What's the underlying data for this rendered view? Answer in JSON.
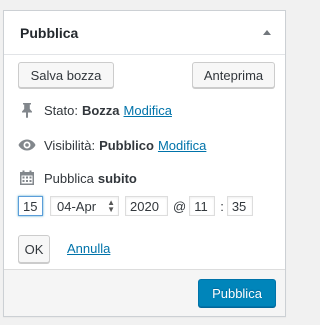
{
  "panel": {
    "title": "Pubblica"
  },
  "actions": {
    "save_draft": "Salva bozza",
    "preview": "Anteprima"
  },
  "status": {
    "label": "Stato:",
    "value": "Bozza",
    "edit_link": "Modifica",
    "icon": "pin-icon"
  },
  "visibility": {
    "label": "Visibilità:",
    "value": "Pubblico",
    "edit_link": "Modifica",
    "icon": "eye-icon"
  },
  "schedule": {
    "label": "Pubblica",
    "value": "subito",
    "icon": "calendar-icon",
    "day": "15",
    "month": "04-Apr",
    "year": "2020",
    "at": "@",
    "hour": "11",
    "colon": ":",
    "minute": "35",
    "ok": "OK",
    "cancel": "Annulla"
  },
  "footer": {
    "publish": "Pubblica"
  },
  "colors": {
    "primary": "#0085ba",
    "link": "#0073aa",
    "icon": "#82878c"
  }
}
